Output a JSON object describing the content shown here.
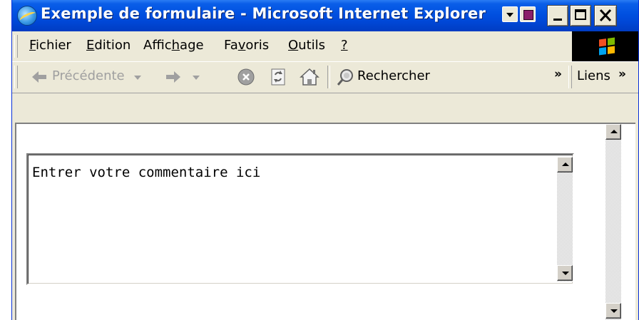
{
  "window": {
    "title": "Exemple de formulaire - Microsoft Internet Explorer"
  },
  "menu": {
    "items": [
      {
        "pre": "",
        "ul": "F",
        "post": "ichier"
      },
      {
        "pre": "",
        "ul": "E",
        "post": "dition"
      },
      {
        "pre": "Affic",
        "ul": "h",
        "post": "age"
      },
      {
        "pre": "Fa",
        "ul": "v",
        "post": "oris"
      },
      {
        "pre": "",
        "ul": "O",
        "post": "utils"
      },
      {
        "pre": "",
        "ul": "?",
        "post": ""
      }
    ]
  },
  "toolbar": {
    "back_label": "Précédente",
    "search_label": "Rechercher",
    "chevron": "»",
    "links_label": "Liens",
    "links_chevron": "»"
  },
  "form": {
    "comment_text": "Entrer votre commentaire ici"
  },
  "colors": {
    "titlebar": "#0050e0",
    "chrome": "#ece9d8",
    "content_bg": "#ffffff"
  },
  "icons": [
    "ie-icon",
    "arrow-left-icon",
    "arrow-right-icon",
    "stop-icon",
    "refresh-icon",
    "home-icon",
    "search-icon",
    "windows-logo-icon"
  ]
}
